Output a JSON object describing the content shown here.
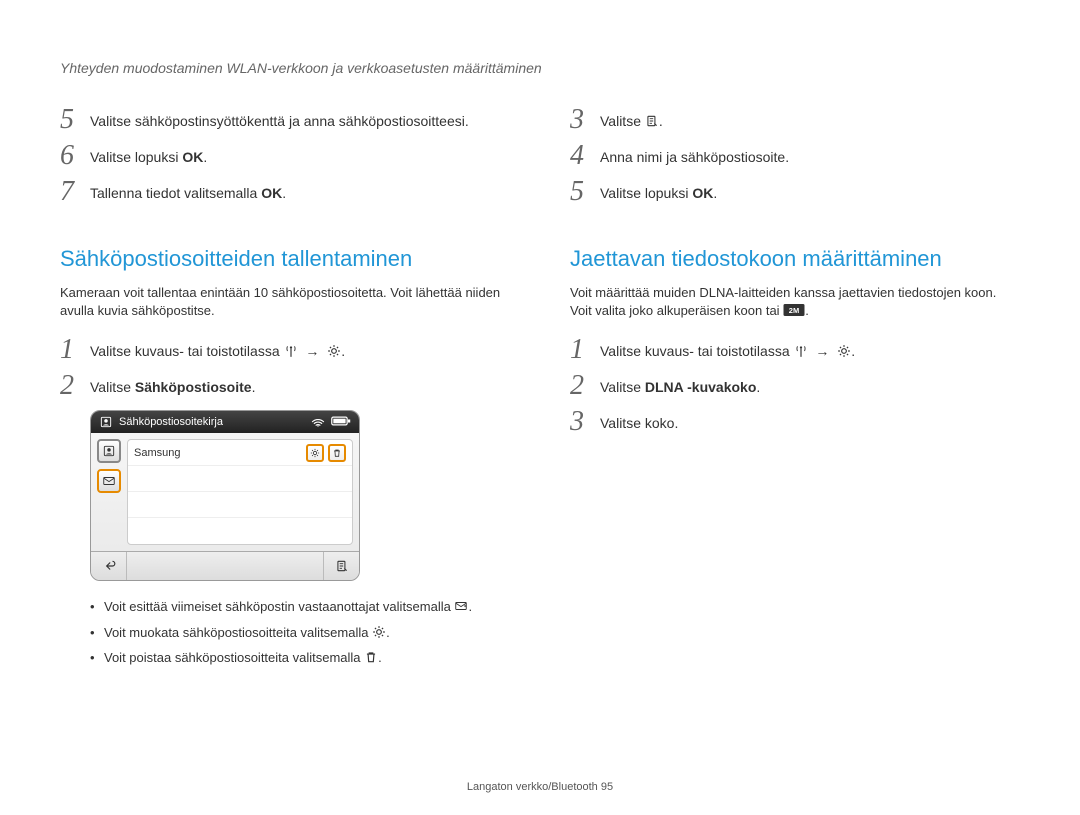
{
  "header": "Yhteyden muodostaminen WLAN-verkkoon ja verkkoasetusten määrittäminen",
  "left": {
    "step5": "Valitse  sähköpostinsyöttökenttä ja anna sähköpostiosoitteesi.",
    "step6a": "Valitse lopuksi ",
    "step6b": "OK",
    "step6c": ".",
    "step7a": "Tallenna tiedot valitsemalla ",
    "step7b": "OK",
    "step7c": ".",
    "section_title": "Sähköpostiosoitteiden tallentaminen",
    "section_desc": "Kameraan voit tallentaa enintään 10 sähköpostiosoitetta. Voit lähettää niiden avulla kuvia sähköpostitse.",
    "step1a": "Valitse kuvaus- tai toistotilassa ",
    "step2a": "Valitse ",
    "step2b": "Sähköpostiosoite",
    "step2c": ".",
    "ui_title": "Sähköpostiosoitekirja",
    "ui_row1": "Samsung",
    "bullet1": "Voit esittää viimeiset sähköpostin vastaanottajat valitsemalla ",
    "bullet2": "Voit muokata sähköpostiosoitteita valitsemalla ",
    "bullet3": "Voit poistaa sähköpostiosoitteita valitsemalla "
  },
  "right": {
    "step3": "Valitse ",
    "step4": "Anna nimi ja sähköpostiosoite.",
    "step5a": "Valitse lopuksi ",
    "step5b": "OK",
    "step5c": ".",
    "section_title": "Jaettavan tiedostokoon määrittäminen",
    "section_desc": "Voit määrittää muiden DLNA-laitteiden kanssa jaettavien tiedostojen koon. Voit valita joko alkuperäisen koon tai ",
    "step1a": "Valitse kuvaus- tai toistotilassa ",
    "step2a": "Valitse ",
    "step2b": "DLNA -kuvakoko",
    "step2c": ".",
    "step3b": "Valitse koko."
  },
  "nums": {
    "n1": "1",
    "n2": "2",
    "n3": "3",
    "n4": "4",
    "n5": "5",
    "n6": "6",
    "n7": "7"
  },
  "footer_a": "Langaton verkko/Bluetooth  ",
  "footer_b": "95"
}
